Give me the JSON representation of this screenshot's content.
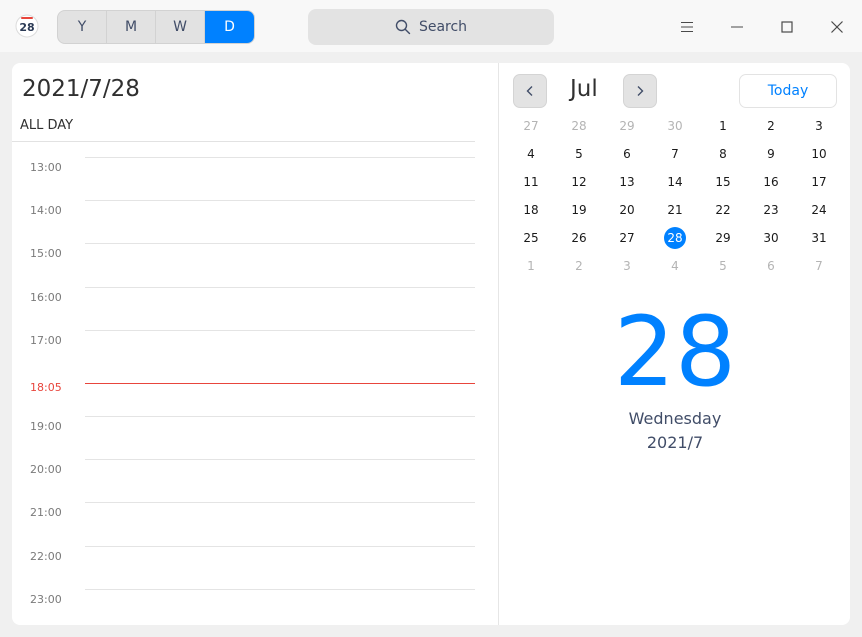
{
  "app": {
    "icon_text": "28"
  },
  "view_switcher": [
    {
      "label": "Y",
      "active": false
    },
    {
      "label": "M",
      "active": false
    },
    {
      "label": "W",
      "active": false
    },
    {
      "label": "D",
      "active": true
    }
  ],
  "search": {
    "label": "Search"
  },
  "day_view": {
    "date_title": "2021/7/28",
    "all_day_label": "ALL DAY",
    "hours": [
      "13:00",
      "14:00",
      "15:00",
      "16:00",
      "17:00",
      "19:00",
      "20:00",
      "21:00",
      "22:00",
      "23:00"
    ],
    "current_time": "18:05"
  },
  "mini_calendar": {
    "month_label": "Jul",
    "today_label": "Today",
    "weeks": [
      [
        "27",
        "28",
        "29",
        "30",
        "1",
        "2",
        "3"
      ],
      [
        "4",
        "5",
        "6",
        "7",
        "8",
        "9",
        "10"
      ],
      [
        "11",
        "12",
        "13",
        "14",
        "15",
        "16",
        "17"
      ],
      [
        "18",
        "19",
        "20",
        "21",
        "22",
        "23",
        "24"
      ],
      [
        "25",
        "26",
        "27",
        "28",
        "29",
        "30",
        "31"
      ],
      [
        "1",
        "2",
        "3",
        "4",
        "5",
        "6",
        "7"
      ]
    ],
    "selected": "28"
  },
  "day_detail": {
    "day": "28",
    "weekday": "Wednesday",
    "year_month": "2021/7"
  },
  "colors": {
    "accent": "#0081ff",
    "current_time": "#e8453c"
  }
}
